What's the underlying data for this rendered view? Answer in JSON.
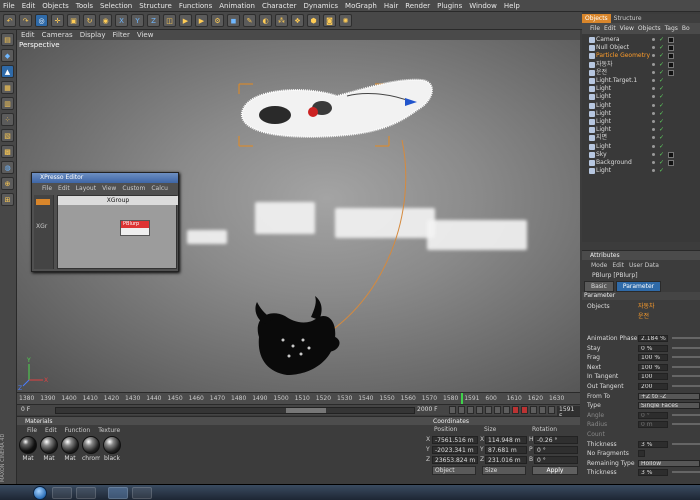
{
  "menubar": [
    "File",
    "Edit",
    "Objects",
    "Tools",
    "Selection",
    "Structure",
    "Functions",
    "Animation",
    "Character",
    "Dynamics",
    "MoGraph",
    "Hair",
    "Render",
    "Plugins",
    "Window",
    "Help"
  ],
  "viewport": {
    "menu": [
      "Edit",
      "Cameras",
      "Display",
      "Filter",
      "View"
    ],
    "label": "Perspective"
  },
  "xpresso": {
    "title": "XPresso Editor",
    "menu": [
      "File",
      "Edit",
      "Layout",
      "View",
      "Custom",
      "Calcu"
    ],
    "group": "XGroup",
    "list_item": "XGr",
    "node": "PBlurp"
  },
  "timeline": {
    "ticks": [
      "1380",
      "1390",
      "1400",
      "1410",
      "1420",
      "1430",
      "1440",
      "1450",
      "1460",
      "1470",
      "1480",
      "1490",
      "1500",
      "1510",
      "1520",
      "1530",
      "1540",
      "1550",
      "1560",
      "1570",
      "1580",
      "1591",
      "600",
      "1610",
      "1620",
      "1630"
    ],
    "start": "0 F",
    "end": "2000 F",
    "current": "1591 F"
  },
  "materials": {
    "title": "Materials",
    "menu": [
      "File",
      "Edit",
      "Function",
      "Texture"
    ],
    "items": [
      "Mat",
      "Mat",
      "Mat",
      "chrom",
      "black"
    ]
  },
  "coordinates": {
    "title": "Coordinates",
    "cols": [
      "Position",
      "Size",
      "Rotation"
    ],
    "rows": [
      {
        "axis": "X",
        "pos": "-7561.516 m",
        "size_axis": "X",
        "size": "114.948 m",
        "rot_axis": "H",
        "rot": "-0.26 °"
      },
      {
        "axis": "Y",
        "pos": "-2023.341 m",
        "size_axis": "Y",
        "size": "87.681 m",
        "rot_axis": "P",
        "rot": "0 °"
      },
      {
        "axis": "Z",
        "pos": "23653.824 m",
        "size_axis": "Z",
        "size": "231.016 m",
        "rot_axis": "B",
        "rot": "0 °"
      }
    ],
    "mode1": "Object",
    "mode2": "Size",
    "apply": "Apply"
  },
  "objects": {
    "tabs": [
      "Objects",
      "Structure"
    ],
    "menu": [
      "File",
      "Edit",
      "View",
      "Objects",
      "Tags",
      "Bo"
    ],
    "items": [
      {
        "name": "Camera",
        "sel": false
      },
      {
        "name": "Null Object",
        "sel": false
      },
      {
        "name": "Particle Geometry",
        "sel": true
      },
      {
        "name": "자동차",
        "sel": false
      },
      {
        "name": "운전",
        "sel": false
      },
      {
        "name": "Light.Target.1",
        "sel": false
      },
      {
        "name": "Light",
        "sel": false
      },
      {
        "name": "Light",
        "sel": false
      },
      {
        "name": "Light",
        "sel": false
      },
      {
        "name": "Light",
        "sel": false
      },
      {
        "name": "Light",
        "sel": false
      },
      {
        "name": "Light",
        "sel": false
      },
      {
        "name": "지면",
        "sel": false
      },
      {
        "name": "Light",
        "sel": false
      },
      {
        "name": "Sky",
        "sel": false
      },
      {
        "name": "Background",
        "sel": false
      },
      {
        "name": "Light",
        "sel": false
      }
    ]
  },
  "attributes": {
    "title": "Attributes",
    "menu": [
      "Mode",
      "Edit",
      "User Data"
    ],
    "object": "PBlurp [PBlurp]",
    "tabs": [
      "Basic",
      "Parameter"
    ],
    "section": "Parameter",
    "objects_label": "Objects",
    "objects_values": [
      "자동차",
      "운전"
    ],
    "rows": [
      {
        "label": "Animation Phase",
        "value": "2.184 %"
      },
      {
        "label": "Stay",
        "value": "0 %"
      },
      {
        "label": "Frag",
        "value": "100 %"
      },
      {
        "label": "Next",
        "value": "100 %"
      },
      {
        "label": "In Tangent",
        "value": "100"
      },
      {
        "label": "Out Tangent",
        "value": "200"
      },
      {
        "label": "From To",
        "value": "+Z to -Z"
      },
      {
        "label": "Type",
        "value": "Single Faces"
      },
      {
        "label": "Angle",
        "value": "0 °"
      },
      {
        "label": "Radius",
        "value": "0 m"
      },
      {
        "label": "Count",
        "value": ""
      },
      {
        "label": "Thickness",
        "value": "3 %"
      },
      {
        "label": "No Fragments",
        "value": ""
      },
      {
        "label": "Remaining Type",
        "value": "Hollow"
      },
      {
        "label": "Thickness",
        "value": "3 %"
      }
    ]
  },
  "maxon": "MAXON CINEMA 4D"
}
